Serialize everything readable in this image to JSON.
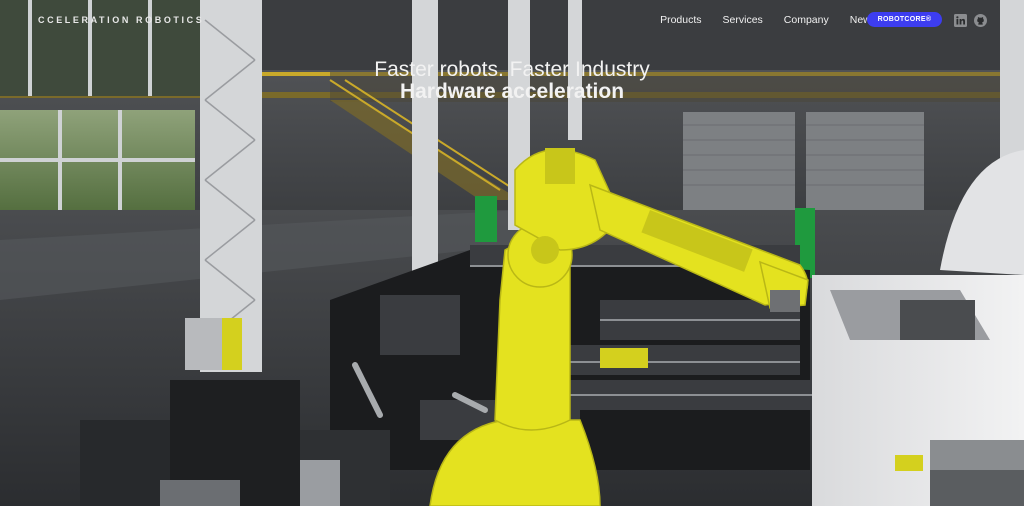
{
  "brand": {
    "logo_text": "CCELERATION ROBOTICS"
  },
  "nav": {
    "items": [
      "Products",
      "Services",
      "Company",
      "News"
    ],
    "cta_label": "ROBOTCORE®",
    "social_icons": [
      "linkedin-icon",
      "github-icon"
    ]
  },
  "hero": {
    "tagline": "Faster robots. Faster Industry",
    "headline": "Hardware acceleration"
  },
  "colors": {
    "accent": "#3d3df0",
    "robot_yellow": "#e4e21f",
    "text": "#f2f2f2"
  }
}
